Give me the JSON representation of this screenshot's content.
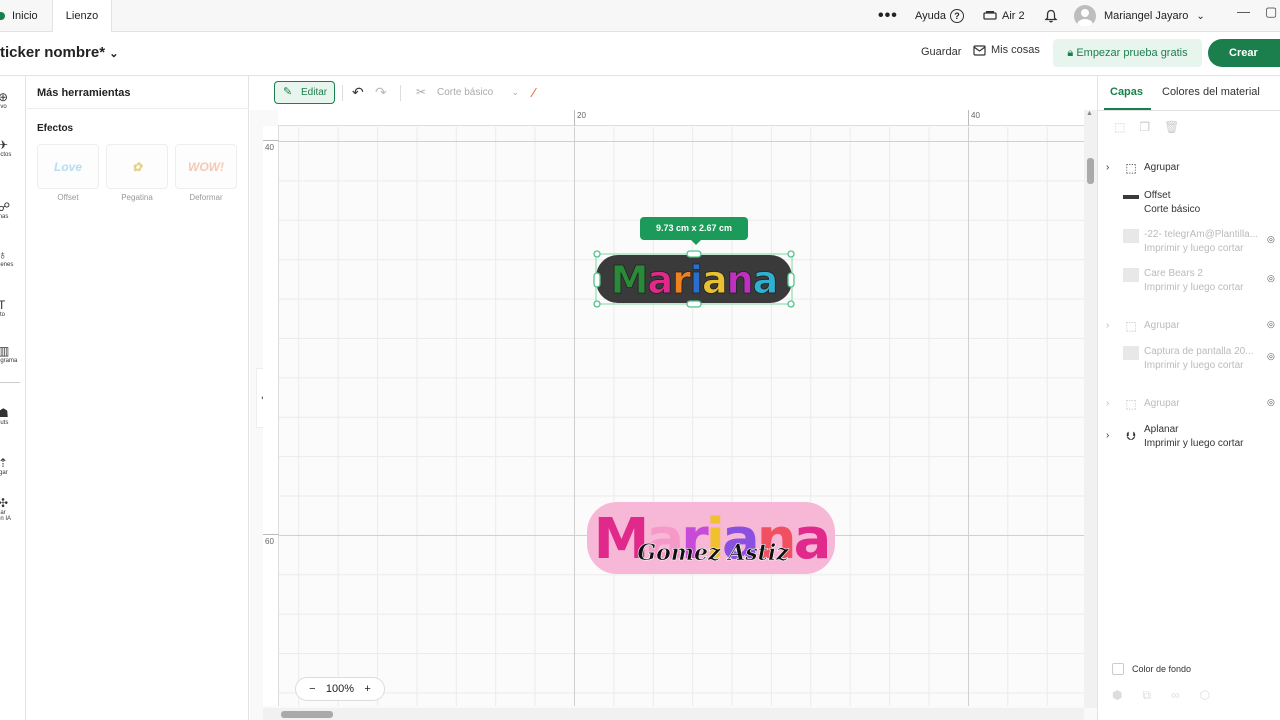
{
  "topbar": {
    "tab_home": "Inicio",
    "tab_canvas": "Lienzo",
    "more": "•••",
    "help": "Ayuda",
    "help_icon": "?",
    "machine": "Air 2",
    "user_name": "Mariangel Jayaro",
    "minimize": "—",
    "maximize": "▢"
  },
  "header": {
    "project_title": "ticker nombre*",
    "save": "Guardar",
    "my_stuff": "Mis cosas",
    "trial": "Empezar prueba gratis",
    "create": "Crear"
  },
  "left_rail": [
    {
      "icon": "plus-circle-icon",
      "glyph": "⊕",
      "label": "evo"
    },
    {
      "icon": "shapes-icon",
      "glyph": "✈",
      "label": "ectos"
    },
    {
      "icon": "formas-icon",
      "glyph": "☍",
      "label": "mas"
    },
    {
      "icon": "lightbulb-icon",
      "glyph": "♁",
      "label": "genes"
    },
    {
      "icon": "text-icon",
      "glyph": "T",
      "label": "xto"
    },
    {
      "icon": "monogram-icon",
      "glyph": "▥",
      "label": "ograma"
    },
    {
      "icon": "templates-icon",
      "glyph": "☗",
      "label": "outs"
    },
    {
      "icon": "upload-icon",
      "glyph": "⇡",
      "label": "rgar"
    },
    {
      "icon": "ai-sparkle-icon",
      "glyph": "✣",
      "label": "ear\non IA"
    }
  ],
  "tools_panel": {
    "title": "Más herramientas",
    "section": "Efectos",
    "effects": [
      {
        "label": "Offset",
        "preview": "Love",
        "color": "#b9dcf2"
      },
      {
        "label": "Pegatina",
        "preview": "✿",
        "color": "#e6d28c"
      },
      {
        "label": "Deformar",
        "preview": "WOW!",
        "color": "#f3c9b3"
      }
    ]
  },
  "canvas_toolbar": {
    "edit": "Editar",
    "operation": "Corte básico"
  },
  "rulers": {
    "top": [
      "20",
      "40"
    ],
    "left": [
      "40",
      "60"
    ]
  },
  "canvas": {
    "dimension_badge": "9.73  cm x 2.67  cm",
    "sticker1_text": "Mariana",
    "sticker1_colors": [
      "#2a8a3a",
      "#e0298a",
      "#f08020",
      "#2a6fd0",
      "#e8c030",
      "#c030c0",
      "#30b0d0"
    ],
    "sticker2_text": "Mariana",
    "sticker2_subtext": "Gomez Astiz",
    "sticker2_colors": [
      "#e0298a",
      "#f59ac8",
      "#c84ad8",
      "#f0c030",
      "#8a50e0",
      "#f05060",
      "#e0298a"
    ],
    "zoom_minus": "−",
    "zoom_level": "100%",
    "zoom_plus": "+"
  },
  "right_panel": {
    "tab_layers": "Capas",
    "tab_colors": "Colores del material",
    "layers": [
      {
        "name": "Agrupar",
        "sub": "",
        "chevron": true,
        "icon": "group-icon",
        "faded": false,
        "eye": false
      },
      {
        "name": "Offset",
        "sub": "Corte básico",
        "chevron": false,
        "icon": "offset-swatch-icon",
        "faded": false,
        "eye": false
      },
      {
        "name": "-22- telegrAm@Plantilla...",
        "sub": "Imprimir y luego cortar",
        "chevron": false,
        "icon": "image-icon",
        "faded": true,
        "eye": true
      },
      {
        "name": "Care Bears 2",
        "sub": "Imprimir y luego cortar",
        "chevron": false,
        "icon": "image-icon",
        "faded": true,
        "eye": true
      },
      {
        "name": "Agrupar",
        "sub": "",
        "chevron": true,
        "icon": "group-icon",
        "faded": true,
        "eye": true
      },
      {
        "name": "Captura de pantalla 20...",
        "sub": "Imprimir y luego cortar",
        "chevron": false,
        "icon": "image-icon",
        "faded": true,
        "eye": true
      },
      {
        "name": "Agrupar",
        "sub": "",
        "chevron": true,
        "icon": "group-icon",
        "faded": true,
        "eye": true
      },
      {
        "name": "Aplanar",
        "sub": "Imprimir y luego cortar",
        "chevron": true,
        "icon": "flatten-icon",
        "faded": false,
        "eye": false
      }
    ],
    "bg_color": "Color de fondo"
  },
  "colors": {
    "brand_green": "#1b7f4d",
    "badge_green": "#1b9a5a"
  }
}
